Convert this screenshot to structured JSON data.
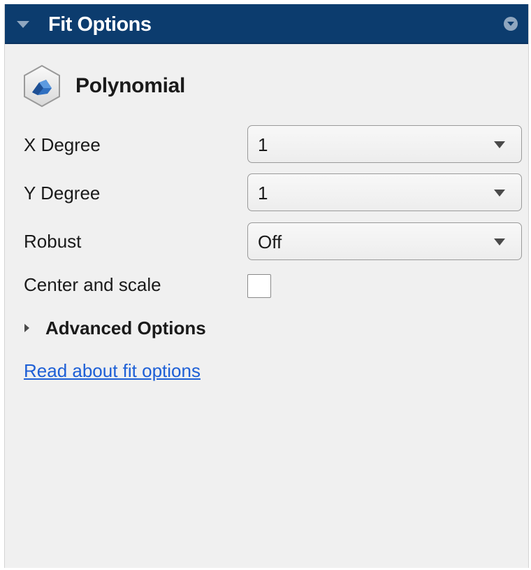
{
  "panel": {
    "title": "Fit Options"
  },
  "fit_type": {
    "label": "Polynomial",
    "icon": "polynomial-surface-icon"
  },
  "options": {
    "x_degree": {
      "label": "X Degree",
      "value": "1"
    },
    "y_degree": {
      "label": "Y Degree",
      "value": "1"
    },
    "robust": {
      "label": "Robust",
      "value": "Off"
    },
    "center_and_scale": {
      "label": "Center and scale",
      "checked": false
    }
  },
  "advanced": {
    "label": "Advanced Options",
    "expanded": false
  },
  "help_link": {
    "label": "Read about fit options"
  },
  "colors": {
    "header_bg": "#0c3c6e",
    "panel_bg": "#f0f0f0",
    "link": "#1d5fd6"
  }
}
